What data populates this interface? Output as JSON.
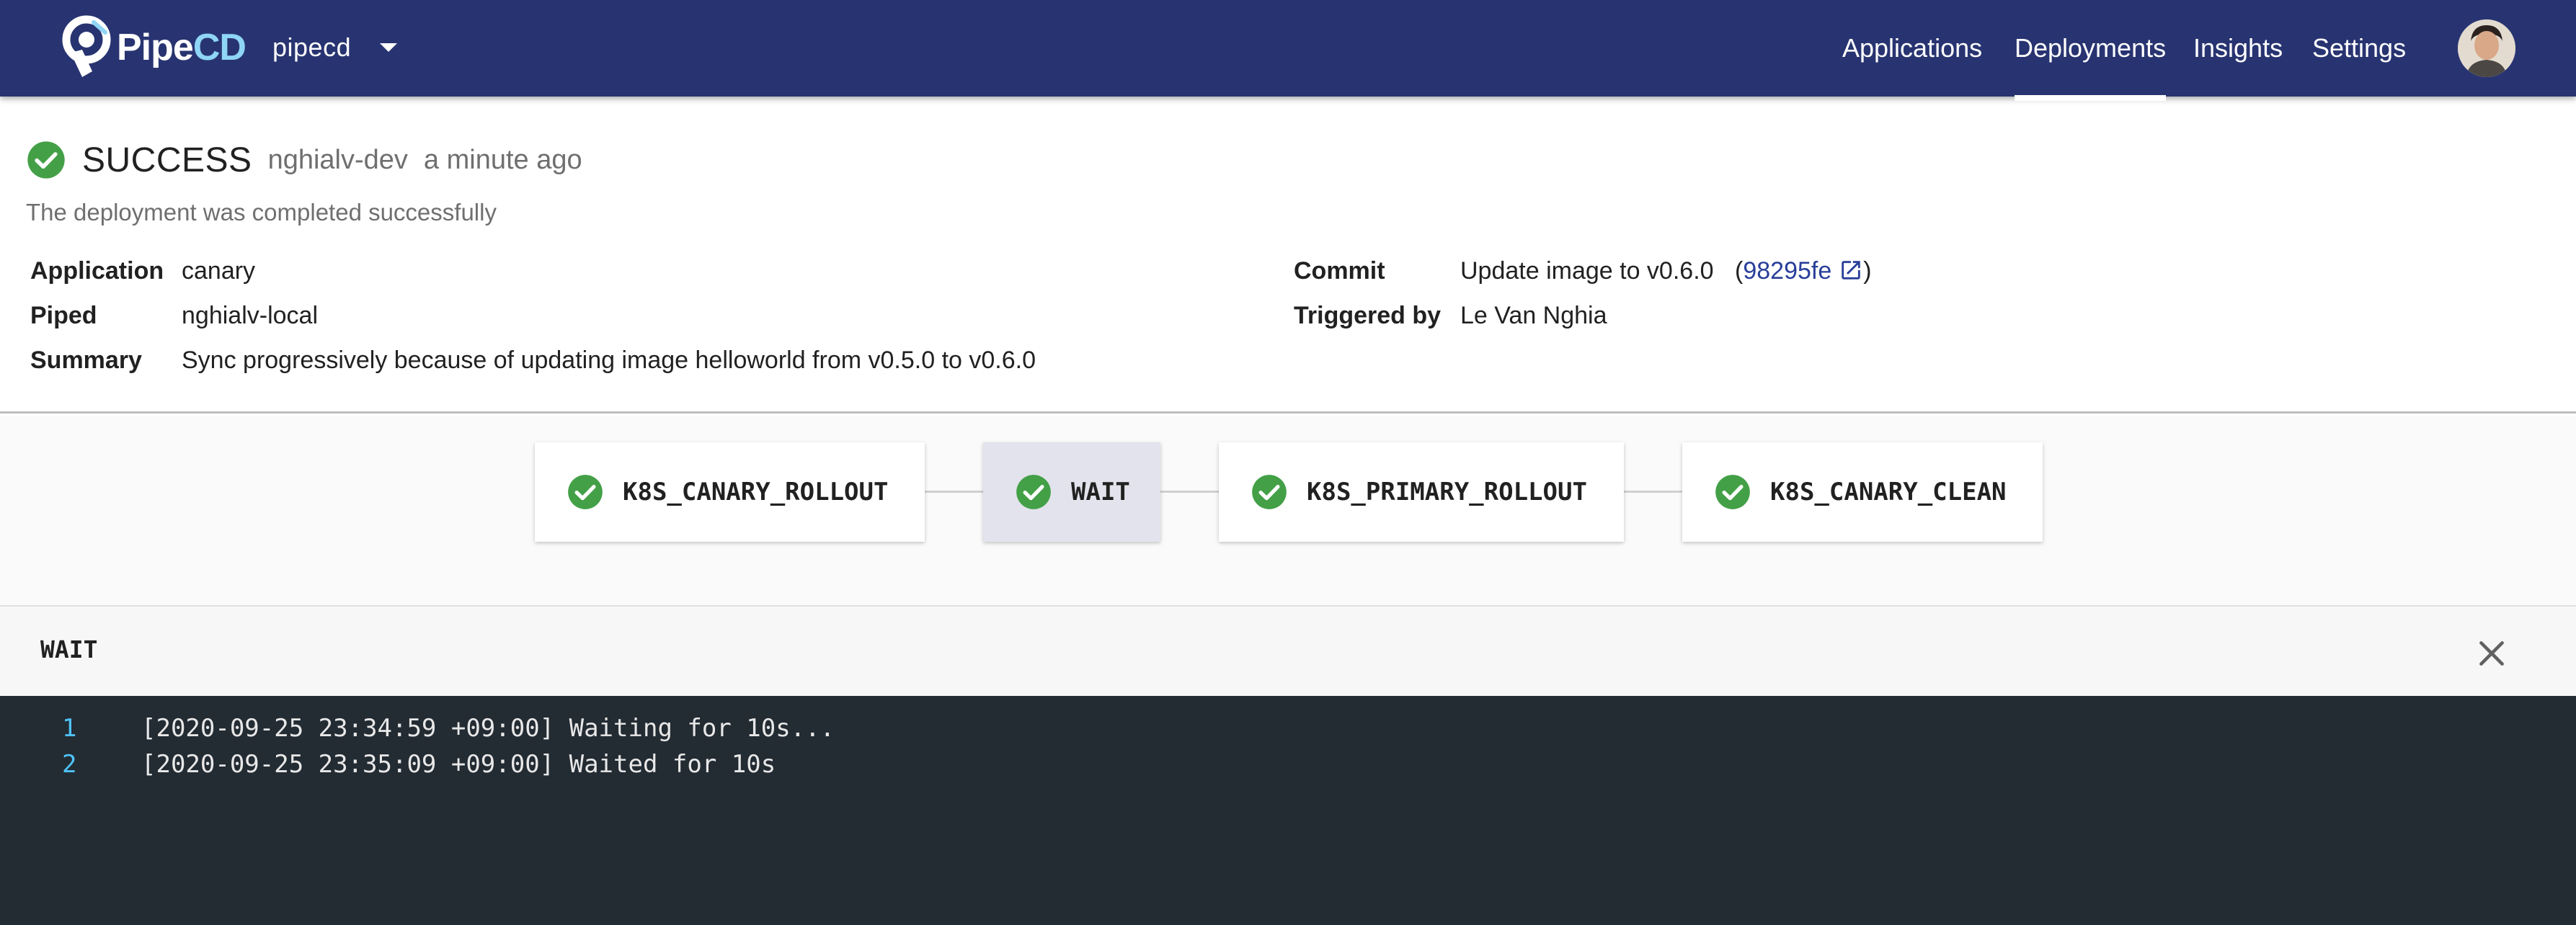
{
  "header": {
    "logo": {
      "text_main": "Pipe",
      "text_accent": "CD"
    },
    "project": {
      "name": "pipecd"
    },
    "nav": [
      {
        "label": "Applications",
        "active": false
      },
      {
        "label": "Deployments",
        "active": true
      },
      {
        "label": "Insights",
        "active": false
      },
      {
        "label": "Settings",
        "active": false
      }
    ],
    "avatar_icon": "user-avatar"
  },
  "deployment": {
    "status": "SUCCESS",
    "env": "nghialv-dev",
    "time": "a minute ago",
    "description": "The deployment was completed successfully",
    "application_label": "Application",
    "application": "canary",
    "piped_label": "Piped",
    "piped": "nghialv-local",
    "summary_label": "Summary",
    "summary": "Sync progressively because of updating image helloworld from v0.5.0 to v0.6.0",
    "commit_label": "Commit",
    "commit_message": "Update image to v0.6.0",
    "commit_open_paren": "(",
    "commit_hash": "98295fe",
    "commit_close_paren": ")",
    "triggered_by_label": "Triggered by",
    "triggered_by": "Le Van Nghia"
  },
  "pipeline": {
    "stages": [
      {
        "name": "K8S_CANARY_ROLLOUT",
        "status": "success"
      },
      {
        "name": "WAIT",
        "status": "success",
        "selected": true
      },
      {
        "name": "K8S_PRIMARY_ROLLOUT",
        "status": "success"
      },
      {
        "name": "K8S_CANARY_CLEAN",
        "status": "success"
      }
    ]
  },
  "log": {
    "title": "WAIT",
    "lines": [
      {
        "num": "1",
        "text": "[2020-09-25 23:34:59 +09:00] Waiting for 10s..."
      },
      {
        "num": "2",
        "text": "[2020-09-25 23:35:09 +09:00] Waited for 10s"
      }
    ]
  },
  "colors": {
    "header_bg": "#283471",
    "success": "#43a047",
    "link": "#283e99",
    "log_bg": "#232b33",
    "log_number": "#4fc3f7"
  }
}
